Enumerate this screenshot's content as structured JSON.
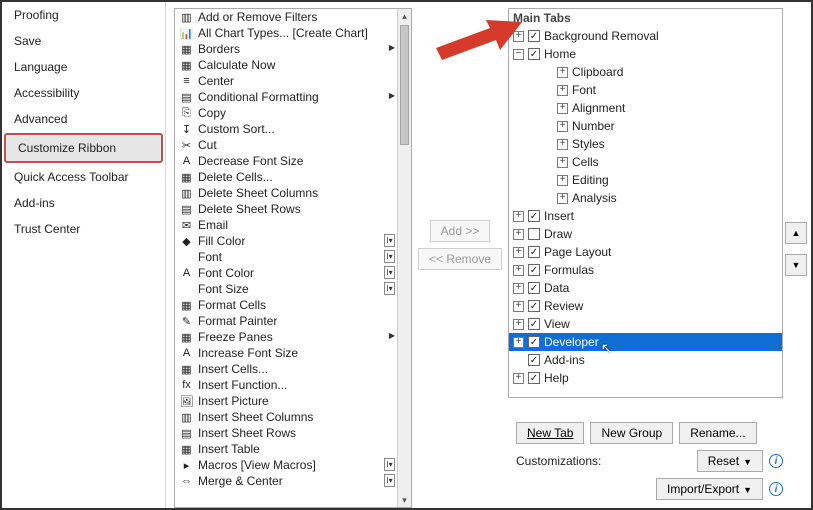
{
  "sidebar": {
    "items": [
      {
        "label": "Proofing"
      },
      {
        "label": "Save"
      },
      {
        "label": "Language"
      },
      {
        "label": "Accessibility"
      },
      {
        "label": "Advanced"
      },
      {
        "label": "Customize Ribbon",
        "selected": true
      },
      {
        "label": "Quick Access Toolbar"
      },
      {
        "label": "Add-ins"
      },
      {
        "label": "Trust Center"
      }
    ]
  },
  "commands": [
    {
      "label": "Add or Remove Filters",
      "icon": "▥"
    },
    {
      "label": "All Chart Types... [Create Chart]",
      "icon": "📊"
    },
    {
      "label": "Borders",
      "icon": "▦",
      "sub": "menu"
    },
    {
      "label": "Calculate Now",
      "icon": "▦"
    },
    {
      "label": "Center",
      "icon": "≡"
    },
    {
      "label": "Conditional Formatting",
      "icon": "▤",
      "sub": "menu"
    },
    {
      "label": "Copy",
      "icon": "⎘"
    },
    {
      "label": "Custom Sort...",
      "icon": "↧"
    },
    {
      "label": "Cut",
      "icon": "✂"
    },
    {
      "label": "Decrease Font Size",
      "icon": "A"
    },
    {
      "label": "Delete Cells...",
      "icon": "▦"
    },
    {
      "label": "Delete Sheet Columns",
      "icon": "▥"
    },
    {
      "label": "Delete Sheet Rows",
      "icon": "▤"
    },
    {
      "label": "Email",
      "icon": "✉"
    },
    {
      "label": "Fill Color",
      "icon": "◆",
      "sub": "dd"
    },
    {
      "label": "Font",
      "icon": "",
      "sub": "dd"
    },
    {
      "label": "Font Color",
      "icon": "A",
      "sub": "dd"
    },
    {
      "label": "Font Size",
      "icon": "",
      "sub": "dd"
    },
    {
      "label": "Format Cells",
      "icon": "▦"
    },
    {
      "label": "Format Painter",
      "icon": "✎"
    },
    {
      "label": "Freeze Panes",
      "icon": "▦",
      "sub": "menu"
    },
    {
      "label": "Increase Font Size",
      "icon": "A"
    },
    {
      "label": "Insert Cells...",
      "icon": "▦"
    },
    {
      "label": "Insert Function...",
      "icon": "fx"
    },
    {
      "label": "Insert Picture",
      "icon": "🖼"
    },
    {
      "label": "Insert Sheet Columns",
      "icon": "▥"
    },
    {
      "label": "Insert Sheet Rows",
      "icon": "▤"
    },
    {
      "label": "Insert Table",
      "icon": "▦"
    },
    {
      "label": "Macros [View Macros]",
      "icon": "▸",
      "sub": "dd"
    },
    {
      "label": "Merge & Center",
      "icon": "⇔",
      "sub": "dd"
    }
  ],
  "center": {
    "add_label": "Add >>",
    "remove_label": "<< Remove"
  },
  "tabs": {
    "header": "Main Tabs",
    "items": [
      {
        "label": "Background Removal",
        "checked": true,
        "exp": "+",
        "level": 1
      },
      {
        "label": "Home",
        "checked": true,
        "exp": "-",
        "level": 1
      },
      {
        "label": "Clipboard",
        "exp": "+",
        "level": 2
      },
      {
        "label": "Font",
        "exp": "+",
        "level": 2
      },
      {
        "label": "Alignment",
        "exp": "+",
        "level": 2
      },
      {
        "label": "Number",
        "exp": "+",
        "level": 2
      },
      {
        "label": "Styles",
        "exp": "+",
        "level": 2
      },
      {
        "label": "Cells",
        "exp": "+",
        "level": 2
      },
      {
        "label": "Editing",
        "exp": "+",
        "level": 2
      },
      {
        "label": "Analysis",
        "exp": "+",
        "level": 2
      },
      {
        "label": "Insert",
        "checked": true,
        "exp": "+",
        "level": 1
      },
      {
        "label": "Draw",
        "checked": false,
        "exp": "+",
        "level": 1
      },
      {
        "label": "Page Layout",
        "checked": true,
        "exp": "+",
        "level": 1
      },
      {
        "label": "Formulas",
        "checked": true,
        "exp": "+",
        "level": 1
      },
      {
        "label": "Data",
        "checked": true,
        "exp": "+",
        "level": 1
      },
      {
        "label": "Review",
        "checked": true,
        "exp": "+",
        "level": 1
      },
      {
        "label": "View",
        "checked": true,
        "exp": "+",
        "level": 1
      },
      {
        "label": "Developer",
        "checked": true,
        "exp": "+",
        "level": 1,
        "selected": true
      },
      {
        "label": "Add-ins",
        "checked": true,
        "exp": "",
        "level": 1
      },
      {
        "label": "Help",
        "checked": true,
        "exp": "+",
        "level": 1
      }
    ]
  },
  "buttons": {
    "new_tab": "New Tab",
    "new_group": "New Group",
    "rename": "Rename...",
    "customizations_label": "Customizations:",
    "reset": "Reset",
    "import_export": "Import/Export"
  },
  "reorder": {
    "up": "▲",
    "down": "▼"
  }
}
